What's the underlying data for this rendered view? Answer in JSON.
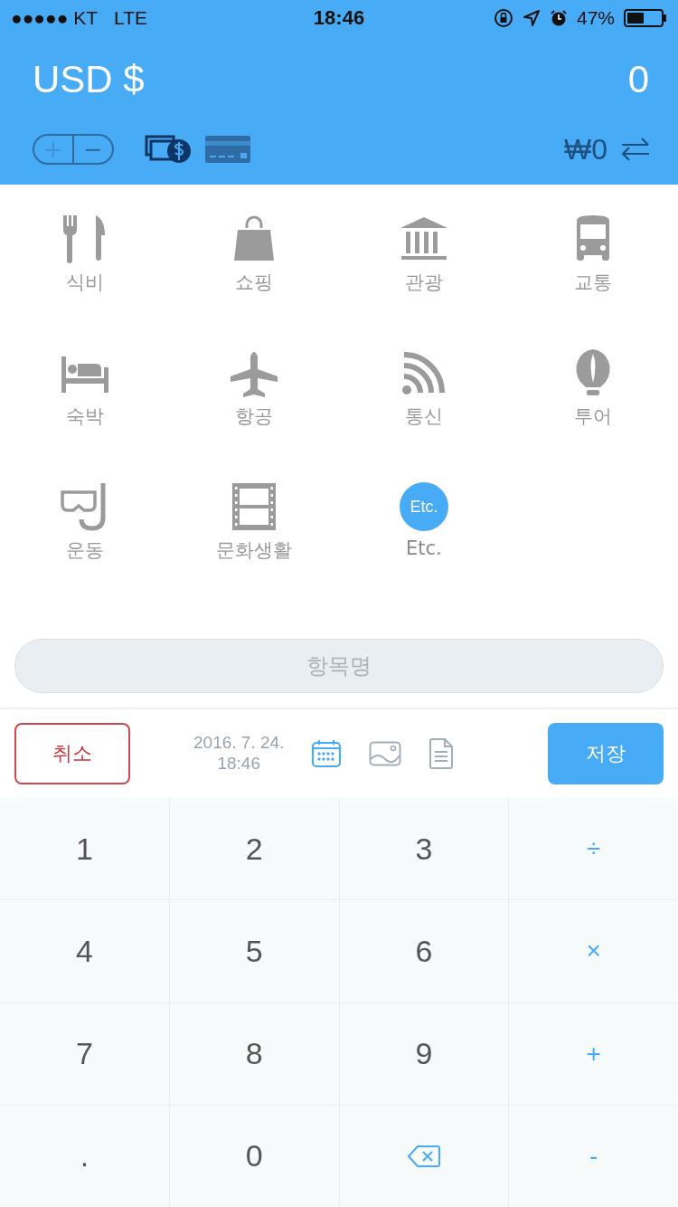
{
  "status_bar": {
    "carrier": "●●●●● KT",
    "network": "LTE",
    "time": "18:46",
    "battery": "47%"
  },
  "header": {
    "currency": "USD $",
    "amount": "0",
    "sign_toggle": [
      {
        "label": "+",
        "selected": false
      },
      {
        "label": "−",
        "selected": true
      }
    ],
    "payment": [
      {
        "kind": "cash",
        "selected": true
      },
      {
        "kind": "card",
        "selected": false
      }
    ],
    "converted": "₩0"
  },
  "categories": [
    {
      "kind": "food",
      "label": "식비",
      "selected": false
    },
    {
      "kind": "shopping",
      "label": "쇼핑",
      "selected": false
    },
    {
      "kind": "sightseeing",
      "label": "관광",
      "selected": false
    },
    {
      "kind": "transport",
      "label": "교통",
      "selected": false
    },
    {
      "kind": "lodging",
      "label": "숙박",
      "selected": false
    },
    {
      "kind": "flight",
      "label": "항공",
      "selected": false
    },
    {
      "kind": "telecom",
      "label": "통신",
      "selected": false
    },
    {
      "kind": "tour",
      "label": "투어",
      "selected": false
    },
    {
      "kind": "sports",
      "label": "운동",
      "selected": false
    },
    {
      "kind": "culture",
      "label": "문화생활",
      "selected": false
    },
    {
      "kind": "etc",
      "label": "Etc.",
      "badge": "Etc.",
      "selected": true
    }
  ],
  "item_field": {
    "placeholder": "항목명"
  },
  "actions": {
    "cancel": "취소",
    "date": "2016. 7. 24.",
    "time": "18:46",
    "save": "저장"
  },
  "keypad": [
    {
      "kind": "digit",
      "label": "1"
    },
    {
      "kind": "digit",
      "label": "2"
    },
    {
      "kind": "digit",
      "label": "3"
    },
    {
      "kind": "operator",
      "label": "÷"
    },
    {
      "kind": "digit",
      "label": "4"
    },
    {
      "kind": "digit",
      "label": "5"
    },
    {
      "kind": "digit",
      "label": "6"
    },
    {
      "kind": "operator",
      "label": "×"
    },
    {
      "kind": "digit",
      "label": "7"
    },
    {
      "kind": "digit",
      "label": "8"
    },
    {
      "kind": "digit",
      "label": "9"
    },
    {
      "kind": "operator",
      "label": "+"
    },
    {
      "kind": "digit",
      "label": "."
    },
    {
      "kind": "digit",
      "label": "0"
    },
    {
      "kind": "backspace"
    },
    {
      "kind": "operator",
      "label": "-"
    }
  ]
}
